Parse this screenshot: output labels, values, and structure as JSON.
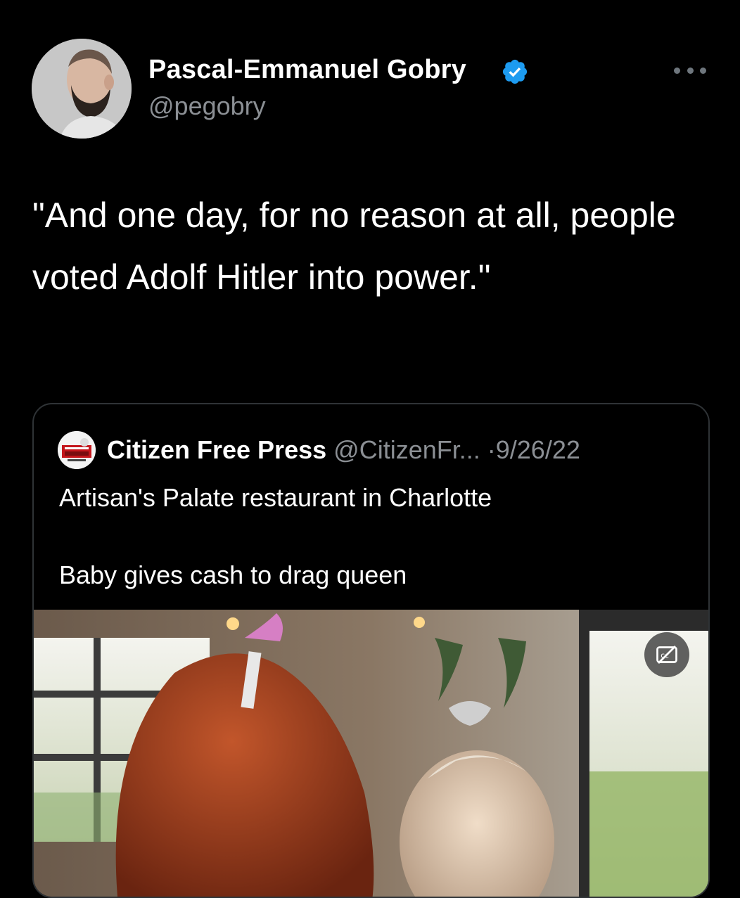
{
  "tweet": {
    "author_name": "Pascal-Emmanuel Gobry",
    "author_handle": "@pegobry",
    "text": "\"And one day, for no reason at all, people voted Adolf Hitler into power.\"",
    "icons": {
      "verified": "verified-badge-icon",
      "more": "more-options-icon"
    }
  },
  "quoted_tweet": {
    "author_name": "Citizen Free Press",
    "author_handle": "@CitizenFr...",
    "separator": "·",
    "date": "9/26/22",
    "text_line_1": "Artisan's Palate restaurant in Charlotte",
    "text_line_2": "Baby gives cash to drag queen",
    "media_controls": {
      "captions_icon": "captions-off-icon"
    }
  },
  "colors": {
    "background": "#000000",
    "text_primary": "#ffffff",
    "text_secondary": "#8b8f94",
    "verified_blue": "#1d9bf0",
    "border": "#2f3336"
  }
}
